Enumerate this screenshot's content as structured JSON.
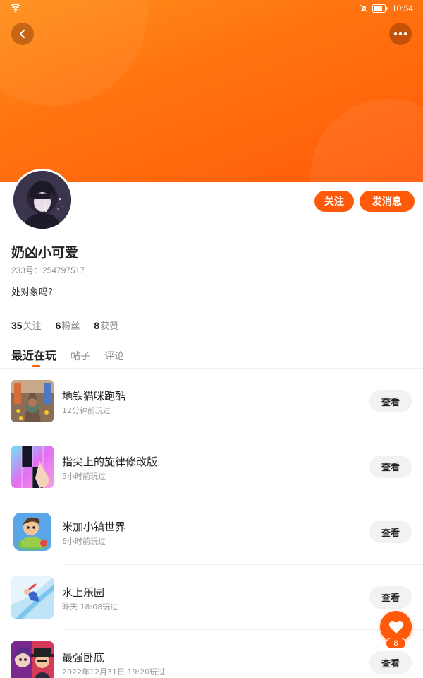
{
  "status_bar": {
    "time": "10:54"
  },
  "profile": {
    "username": "奶凶小可爱",
    "uid": "233号：254797517",
    "bio": "处对象吗?",
    "follow_label": "关注",
    "message_label": "发消息"
  },
  "stats": [
    {
      "count": "35",
      "label": "关注"
    },
    {
      "count": "6",
      "label": "粉丝"
    },
    {
      "count": "8",
      "label": "获赞"
    }
  ],
  "tabs": [
    {
      "label": "最近在玩",
      "active": true
    },
    {
      "label": "帖子",
      "active": false
    },
    {
      "label": "评论",
      "active": false
    }
  ],
  "games": [
    {
      "name": "地铁猫咪跑酷",
      "time": "12分钟前玩过",
      "action": "查看",
      "icon": "subway-cat-game-icon"
    },
    {
      "name": "指尖上的旋律修改版",
      "time": "5小时前玩过",
      "action": "查看",
      "icon": "piano-tiles-game-icon"
    },
    {
      "name": "米加小镇世界",
      "time": "6小时前玩过",
      "action": "查看",
      "icon": "miga-town-game-icon"
    },
    {
      "name": "水上乐园",
      "time": "昨天 18:08玩过",
      "action": "查看",
      "icon": "water-park-game-icon"
    },
    {
      "name": "最强卧底",
      "time": "2022年12月31日 19:20玩过",
      "action": "查看",
      "icon": "undercover-game-icon"
    }
  ],
  "like_fab": {
    "count": "8"
  },
  "colors": {
    "accent": "#ff5a0a",
    "banner": "#ff7410"
  }
}
